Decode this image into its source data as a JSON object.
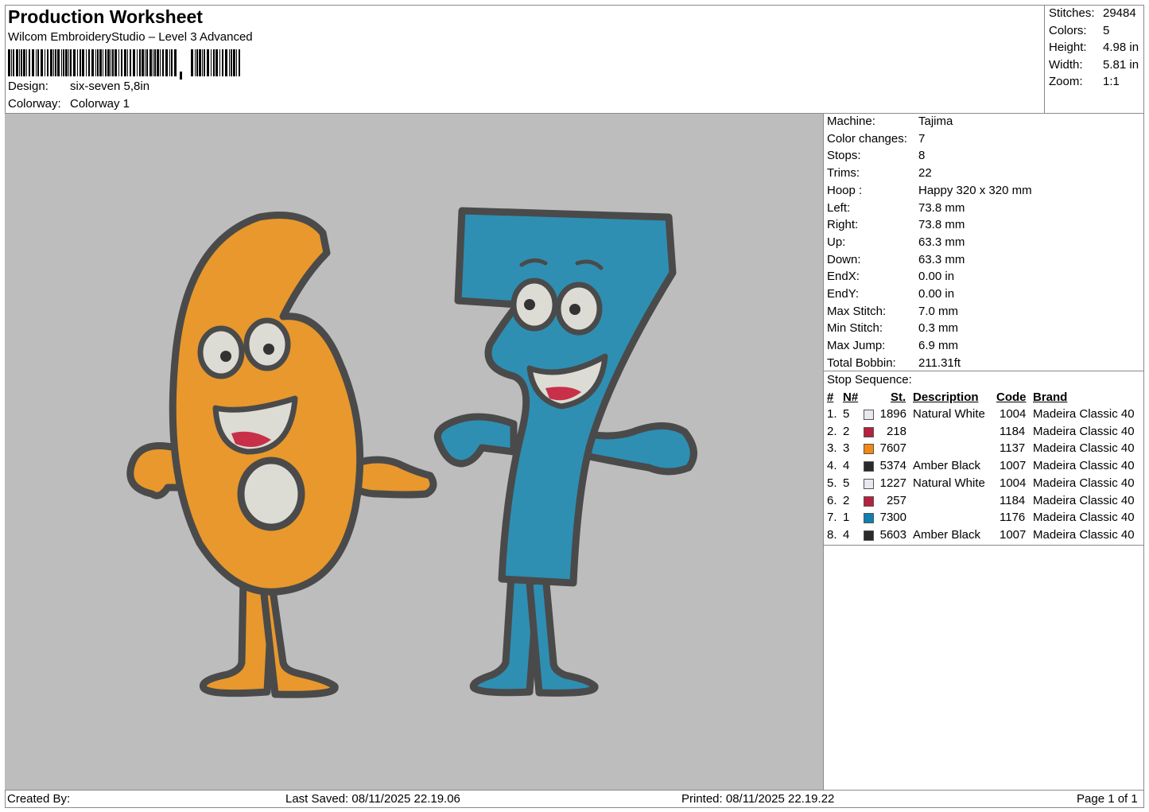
{
  "header": {
    "title": "Production Worksheet",
    "subtitle": "Wilcom EmbroideryStudio – Level 3 Advanced",
    "design_label": "Design:",
    "design_value": "six-seven 5,8in",
    "colorway_label": "Colorway:",
    "colorway_value": "Colorway 1"
  },
  "summary": {
    "stitches_label": "Stitches:",
    "stitches_value": "29484",
    "colors_label": "Colors:",
    "colors_value": "5",
    "height_label": "Height:",
    "height_value": "4.98 in",
    "width_label": "Width:",
    "width_value": "5.81 in",
    "zoom_label": "Zoom:",
    "zoom_value": "1:1"
  },
  "info": [
    {
      "k": "Machine:",
      "v": "Tajima"
    },
    {
      "k": "Color changes:",
      "v": "7"
    },
    {
      "k": "Stops:",
      "v": "8"
    },
    {
      "k": "Trims:",
      "v": "22"
    },
    {
      "k": "Hoop :",
      "v": "Happy 320 x 320 mm"
    },
    {
      "k": "Left:",
      "v": "73.8 mm"
    },
    {
      "k": "Right:",
      "v": "73.8 mm"
    },
    {
      "k": "Up:",
      "v": "63.3 mm"
    },
    {
      "k": "Down:",
      "v": "63.3 mm"
    },
    {
      "k": "EndX:",
      "v": "0.00 in"
    },
    {
      "k": "EndY:",
      "v": "0.00 in"
    },
    {
      "k": "Max Stitch:",
      "v": "7.0 mm"
    },
    {
      "k": "Min Stitch:",
      "v": "0.3 mm"
    },
    {
      "k": "Max Jump:",
      "v": "6.9 mm"
    },
    {
      "k": "Total Bobbin:",
      "v": "211.31ft"
    }
  ],
  "stops": {
    "title": "Stop Sequence:",
    "headers": {
      "num": "#",
      "n": "N#",
      "st": "St.",
      "desc": "Description",
      "code": "Code",
      "brand": "Brand"
    },
    "rows": [
      {
        "num": "1.",
        "n": "5",
        "color": "#e8e8ee",
        "st": "1896",
        "desc": "Natural White",
        "code": "1004",
        "brand": "Madeira Classic 40"
      },
      {
        "num": "2.",
        "n": "2",
        "color": "#b5213f",
        "st": "218",
        "desc": "",
        "code": "1184",
        "brand": "Madeira Classic 40"
      },
      {
        "num": "3.",
        "n": "3",
        "color": "#f08a12",
        "st": "7607",
        "desc": "",
        "code": "1137",
        "brand": "Madeira Classic 40"
      },
      {
        "num": "4.",
        "n": "4",
        "color": "#2a2a2a",
        "st": "5374",
        "desc": "Amber Black",
        "code": "1007",
        "brand": "Madeira Classic 40"
      },
      {
        "num": "5.",
        "n": "5",
        "color": "#e8e8ee",
        "st": "1227",
        "desc": "Natural White",
        "code": "1004",
        "brand": "Madeira Classic 40"
      },
      {
        "num": "6.",
        "n": "2",
        "color": "#b5213f",
        "st": "257",
        "desc": "",
        "code": "1184",
        "brand": "Madeira Classic 40"
      },
      {
        "num": "7.",
        "n": "1",
        "color": "#0f7fb0",
        "st": "7300",
        "desc": "",
        "code": "1176",
        "brand": "Madeira Classic 40"
      },
      {
        "num": "8.",
        "n": "4",
        "color": "#2a2a2a",
        "st": "5603",
        "desc": "Amber Black",
        "code": "1007",
        "brand": "Madeira Classic 40"
      }
    ]
  },
  "footer": {
    "created": "Created By:",
    "saved": "Last Saved: 08/11/2025 22.19.06",
    "printed": "Printed: 08/11/2025 22.19.22",
    "page": "Page 1 of 1"
  },
  "colors": {
    "background": "#bdbdbd",
    "six": "#e8982c",
    "seven": "#2e8fb3",
    "outline": "#4a4a4a",
    "white": "#dcdcd4",
    "mouth": "#c8304a"
  }
}
